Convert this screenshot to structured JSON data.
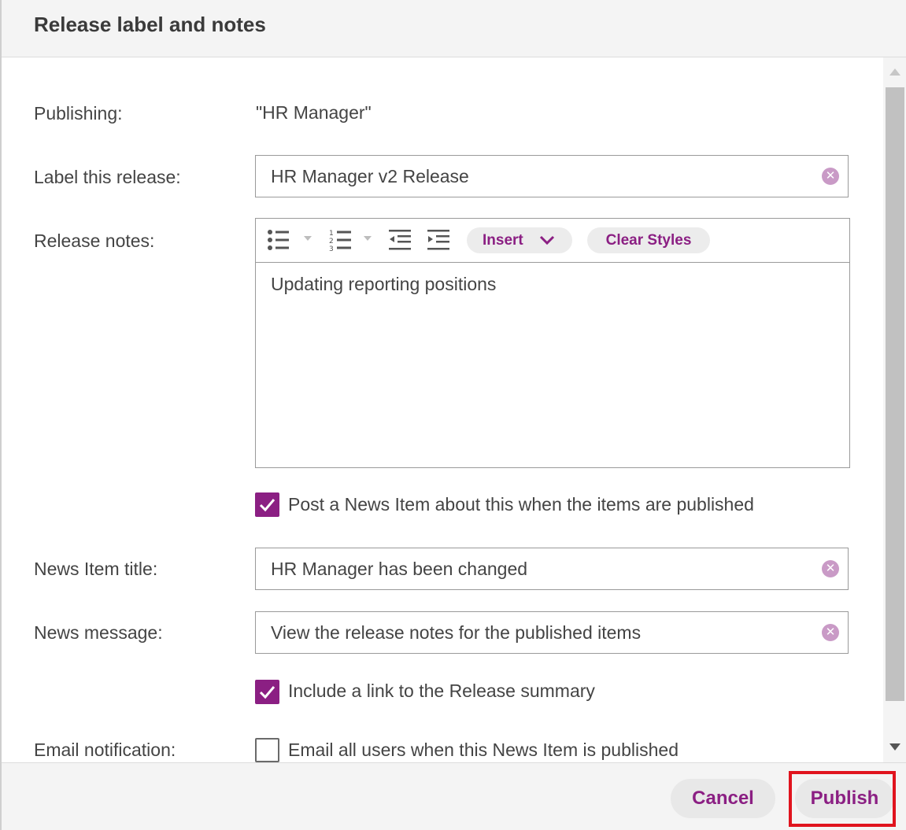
{
  "dialog": {
    "title": "Release label and notes"
  },
  "form": {
    "publishing_label": "Publishing:",
    "publishing_value": "\"HR Manager\"",
    "release_label": "Label this release:",
    "release_value": "HR Manager v2 Release",
    "notes_label": "Release notes:",
    "notes_content": "Updating reporting positions",
    "post_news_label": "Post a News Item about this when the items are published",
    "post_news_checked": true,
    "news_title_label": "News Item title:",
    "news_title_value": "HR Manager has been changed",
    "news_message_label": "News message:",
    "news_message_value": "View the release notes for the published items",
    "include_link_label": "Include a link to the Release summary",
    "include_link_checked": true,
    "email_label": "Email notification:",
    "email_option_label": "Email all users when this News Item is published",
    "email_checked": false
  },
  "toolbar": {
    "insert_label": "Insert",
    "clear_styles_label": "Clear Styles"
  },
  "icons": {
    "bullet_list": "bullet-list-icon",
    "numbered_list": "numbered-list-icon",
    "outdent": "outdent-icon",
    "indent": "indent-icon",
    "clear": "clear-circle-icon",
    "check": "checkmark-icon"
  },
  "footer": {
    "cancel_label": "Cancel",
    "publish_label": "Publish"
  },
  "colors": {
    "accent": "#8b1f83",
    "clear_icon": "#c99ac6",
    "highlight": "#e0141e"
  }
}
